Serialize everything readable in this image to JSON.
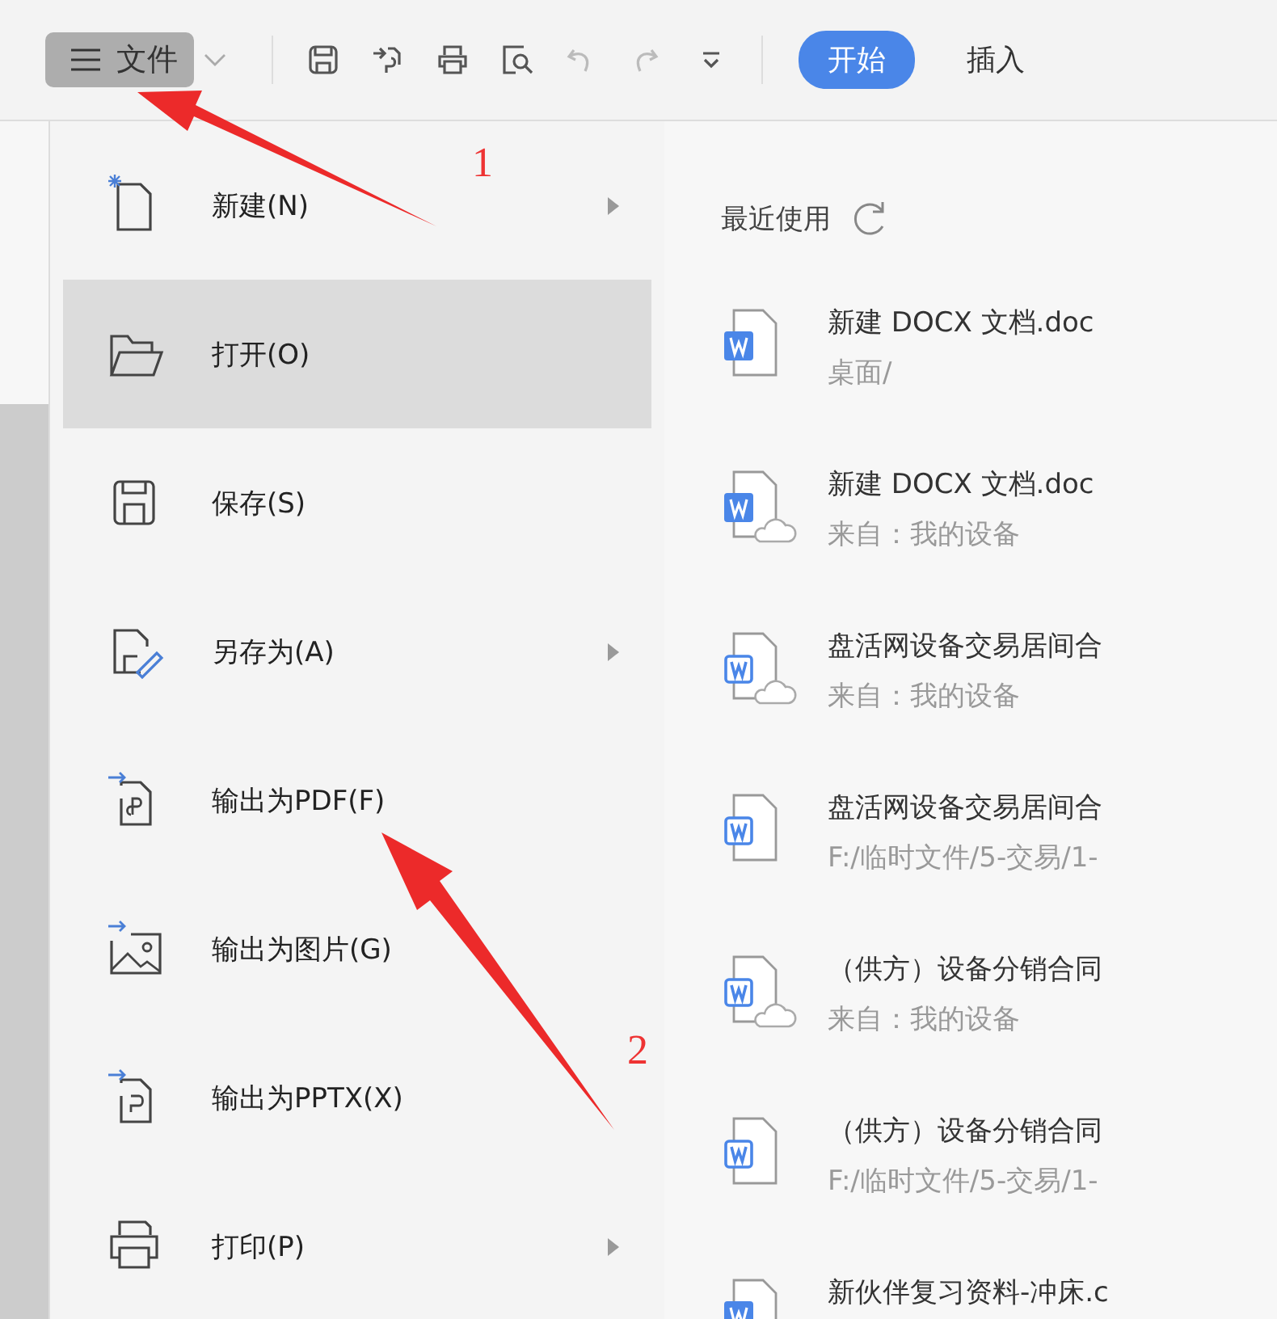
{
  "toolbar": {
    "file_menu": {
      "label": "文件",
      "selected": true
    },
    "quick_icons": [
      {
        "kind": "save"
      },
      {
        "kind": "export"
      },
      {
        "kind": "print"
      },
      {
        "kind": "preview"
      },
      {
        "kind": "undo",
        "disabled": true
      },
      {
        "kind": "redo",
        "disabled": true
      },
      {
        "kind": "more",
        "disabled": false
      }
    ],
    "tabs": [
      {
        "label": "开始",
        "selected": true
      },
      {
        "label": "插入",
        "selected": false
      }
    ]
  },
  "menu": {
    "items": [
      {
        "kind": "new",
        "label": "新建(N)",
        "submenu": true,
        "selected": false
      },
      {
        "kind": "open",
        "label": "打开(O)",
        "submenu": false,
        "selected": true
      },
      {
        "kind": "save",
        "label": "保存(S)",
        "submenu": false,
        "selected": false
      },
      {
        "kind": "saveas",
        "label": "另存为(A)",
        "submenu": true,
        "selected": false
      },
      {
        "kind": "pdf",
        "label": "输出为PDF(F)",
        "submenu": false,
        "selected": false
      },
      {
        "kind": "image",
        "label": "输出为图片(G)",
        "submenu": false,
        "selected": false
      },
      {
        "kind": "pptx",
        "label": "输出为PPTX(X)",
        "submenu": false,
        "selected": false
      },
      {
        "kind": "print",
        "label": "打印(P)",
        "submenu": true,
        "selected": false
      }
    ]
  },
  "recent": {
    "title": "最近使用",
    "files": [
      {
        "name": "新建 DOCX 文档.doc",
        "path": "桌面/",
        "kind": "solid",
        "cloud": false
      },
      {
        "name": "新建 DOCX 文档.doc",
        "path": "来自：我的设备",
        "kind": "solid",
        "cloud": true
      },
      {
        "name": "盘活网设备交易居间合",
        "path": "来自：我的设备",
        "kind": "outline",
        "cloud": true
      },
      {
        "name": "盘活网设备交易居间合",
        "path": "F:/临时文件/5-交易/1-",
        "kind": "outline",
        "cloud": false
      },
      {
        "name": "（供方）设备分销合同",
        "path": "来自：我的设备",
        "kind": "outline",
        "cloud": true
      },
      {
        "name": "（供方）设备分销合同",
        "path": "F:/临时文件/5-交易/1-",
        "kind": "outline",
        "cloud": false
      },
      {
        "name": "新伙伴复习资料-冲床.c",
        "kind": "solid"
      }
    ]
  },
  "annotations": [
    {
      "label": "1"
    },
    {
      "label": "2"
    }
  ]
}
